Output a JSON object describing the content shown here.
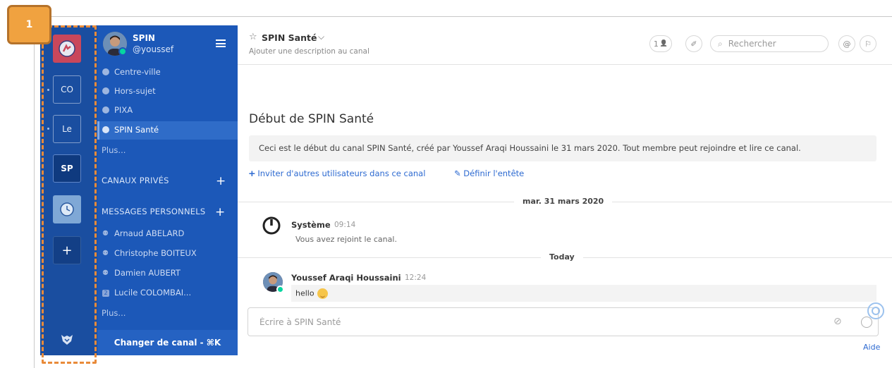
{
  "annotation": {
    "badge": "1"
  },
  "teams": [
    {
      "label": ""
    },
    {
      "label": "CO"
    },
    {
      "label": "Le"
    },
    {
      "label": "SP"
    },
    {
      "label": ""
    },
    {
      "label": "+"
    }
  ],
  "user": {
    "team_name": "SPIN",
    "username": "@youssef"
  },
  "channels": [
    {
      "label": "Centre-ville"
    },
    {
      "label": "Hors-sujet"
    },
    {
      "label": "PIXA"
    },
    {
      "label": "SPIN Santé"
    }
  ],
  "public_more": "Plus...",
  "private": {
    "title": "CANAUX PRIVÉS",
    "add": "+"
  },
  "dms": {
    "title": "MESSAGES PERSONNELS",
    "add": "+",
    "items": [
      {
        "label": "Arnaud ABELARD"
      },
      {
        "label": "Christophe BOITEUX"
      },
      {
        "label": "Damien AUBERT"
      },
      {
        "label": "Lucile COLOMBAI...",
        "badge": "2"
      }
    ],
    "more": "Plus..."
  },
  "switch_channel": "Changer de canal - ⌘K",
  "header": {
    "star": "☆",
    "title": "SPIN Santé",
    "chevron": "⌵",
    "description": "Ajouter une description au canal",
    "members": "1",
    "members_icon": "👤",
    "pin_icon": "✐",
    "search_placeholder": "Rechercher",
    "at": "@",
    "flag": "⚐"
  },
  "intro": {
    "title": "Début de SPIN Santé",
    "text": "Ceci est le début du canal SPIN Santé, créé par Youssef Araqi Houssaini le 31 mars 2020. Tout membre peut rejoindre et lire ce canal.",
    "invite": "Inviter d'autres utilisateurs dans ce canal",
    "set_header": "Définir l'entête"
  },
  "date_separators": {
    "first": "mar. 31 mars 2020",
    "second": "Today"
  },
  "messages": [
    {
      "author": "Système",
      "time": "09:14",
      "text": "Vous avez rejoint le canal."
    },
    {
      "author": "Youssef Araqi Houssaini",
      "time": "12:24",
      "text": "hello"
    }
  ],
  "composer": {
    "placeholder": "Écrire à SPIN Santé"
  },
  "help": "Aide"
}
